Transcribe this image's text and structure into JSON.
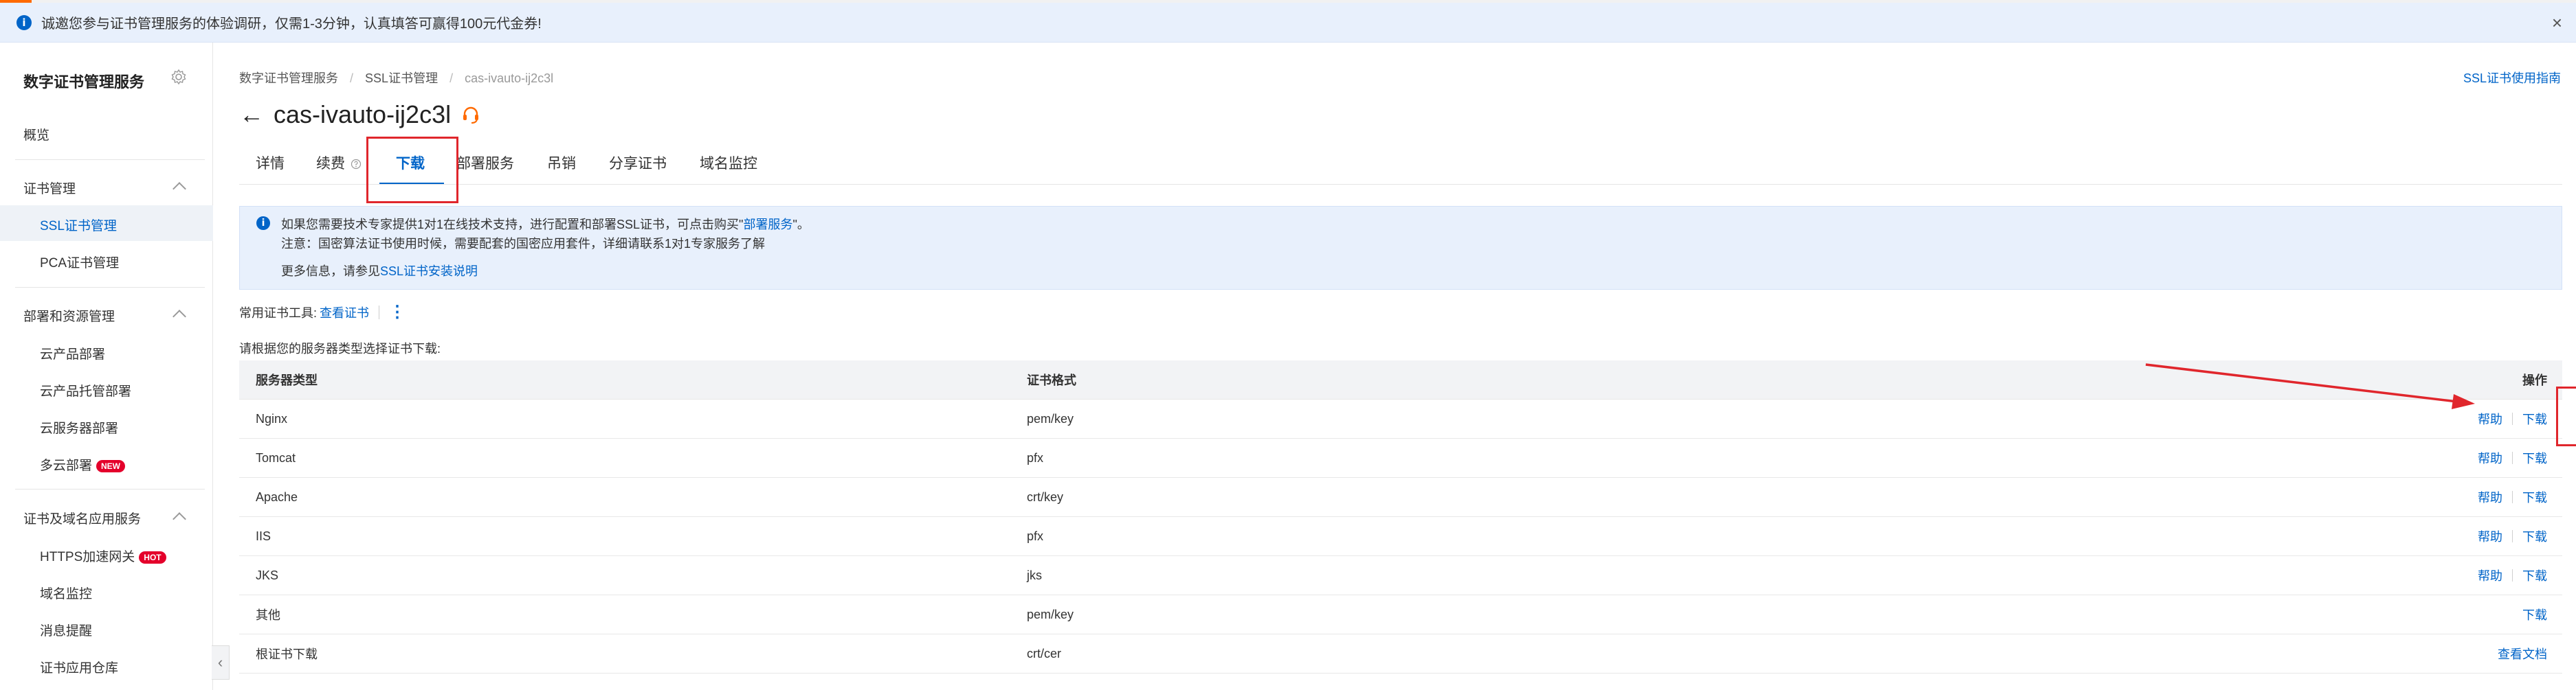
{
  "banner": {
    "info_icon": "i",
    "text": "诚邀您参与证书管理服务的体验调研，仅需1-3分钟，认真填答可赢得100元代金券!",
    "close_icon": "×"
  },
  "sidebar": {
    "title": "数字证书管理服务",
    "overview": "概览",
    "group_cert": "证书管理",
    "ssl_cert": "SSL证书管理",
    "pca_cert": "PCA证书管理",
    "group_deploy": "部署和资源管理",
    "cloud_product_deploy": "云产品部署",
    "cloud_product_managed": "云产品托管部署",
    "cloud_server_deploy": "云服务器部署",
    "multi_cloud": "多云部署",
    "new_badge": "NEW",
    "group_apps": "证书及域名应用服务",
    "https_gateway": "HTTPS加速网关",
    "hot_badge": "HOT",
    "domain_monitor": "域名监控",
    "msg_remind": "消息提醒",
    "cert_repo": "证书应用仓库",
    "collapse_icon": "‹"
  },
  "breadcrumb": {
    "item1": "数字证书管理服务",
    "item2": "SSL证书管理",
    "item3": "cas-ivauto-ij2c3l",
    "sep": "/"
  },
  "help_link": "SSL证书使用指南",
  "page": {
    "back_icon": "←",
    "title": "cas-ivauto-ij2c3l"
  },
  "tabs": {
    "details": "详情",
    "renew": "续费",
    "download": "下载",
    "deploy": "部署服务",
    "revoke": "吊销",
    "share": "分享证书",
    "domain_monitor": "域名监控"
  },
  "notice": {
    "icon": "i",
    "line1_prefix": "如果您需要技术专家提供1对1在线技术支持，进行配置和部署SSL证书，可点击购买\"",
    "line1_link": "部署服务",
    "line1_suffix": "\"。",
    "line2": "注意：国密算法证书使用时候，需要配套的国密应用套件，详细请联系1对1专家服务了解",
    "line3_prefix": "更多信息，请参见",
    "line3_link": "SSL证书安装说明"
  },
  "tools": {
    "label": "常用证书工具:",
    "view_cert": "查看证书",
    "more_icon": "⋮"
  },
  "instruction": "请根据您的服务器类型选择证书下载:",
  "table": {
    "headers": {
      "server_type": "服务器类型",
      "format": "证书格式",
      "ops": "操作"
    },
    "help": "帮助",
    "download": "下载",
    "rows": [
      {
        "type": "Nginx",
        "format": "pem/key",
        "has_help": true,
        "action": "下载"
      },
      {
        "type": "Tomcat",
        "format": "pfx",
        "has_help": true,
        "action": "下载"
      },
      {
        "type": "Apache",
        "format": "crt/key",
        "has_help": true,
        "action": "下载"
      },
      {
        "type": "IIS",
        "format": "pfx",
        "has_help": true,
        "action": "下载"
      },
      {
        "type": "JKS",
        "format": "jks",
        "has_help": true,
        "action": "下载"
      },
      {
        "type": "其他",
        "format": "pem/key",
        "has_help": false,
        "action": "下载"
      },
      {
        "type": "根证书下载",
        "format": "crt/cer",
        "has_help": false,
        "action": "查看文档"
      }
    ]
  },
  "colors": {
    "accent": "#0064c8",
    "annotation_red": "#e0262c",
    "badge_red": "#e4002b",
    "brand_orange": "#ff6a00"
  }
}
